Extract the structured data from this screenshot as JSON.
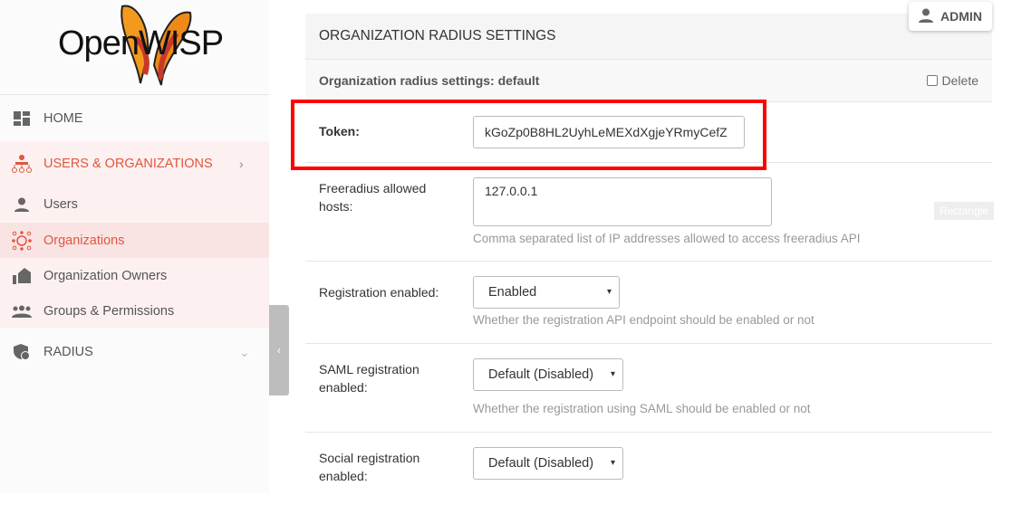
{
  "brand": {
    "logo_text": "OpenWISP"
  },
  "sidebar": {
    "items": [
      {
        "label": "HOME",
        "icon": "dashboard-icon"
      },
      {
        "label": "USERS & ORGANIZATIONS",
        "icon": "hierarchy-icon",
        "active": true
      },
      {
        "label": "Users",
        "icon": "user-icon"
      },
      {
        "label": "Organizations",
        "icon": "organization-icon",
        "selected": true
      },
      {
        "label": "Organization Owners",
        "icon": "owner-icon"
      },
      {
        "label": "Groups & Permissions",
        "icon": "group-icon"
      },
      {
        "label": "RADIUS",
        "icon": "shield-icon"
      }
    ],
    "toggle": "‹"
  },
  "user_menu": {
    "label": "ADMIN"
  },
  "panel": {
    "title": "ORGANIZATION RADIUS SETTINGS",
    "subtitle": "Organization radius settings: default",
    "delete_label": "Delete",
    "fields": {
      "token": {
        "label": "Token:",
        "value": "kGoZp0B8HL2UyhLeMEXdXgjeYRmyCefZ"
      },
      "freeradius": {
        "label": "Freeradius allowed hosts:",
        "value": "127.0.0.1",
        "help": "Comma separated list of IP addresses allowed to access freeradius API"
      },
      "registration": {
        "label": "Registration enabled:",
        "value": "Enabled",
        "help": "Whether the registration API endpoint should be enabled or not"
      },
      "saml": {
        "label": "SAML registration enabled:",
        "value": "Default (Disabled)",
        "help": "Whether the registration using SAML should be enabled or not"
      },
      "social": {
        "label": "Social registration enabled:",
        "value": "Default (Disabled)"
      }
    }
  },
  "overlay": {
    "rectangle_label": "Rectangle"
  },
  "colors": {
    "accent": "#e0563f",
    "highlight": "#ff0000"
  }
}
